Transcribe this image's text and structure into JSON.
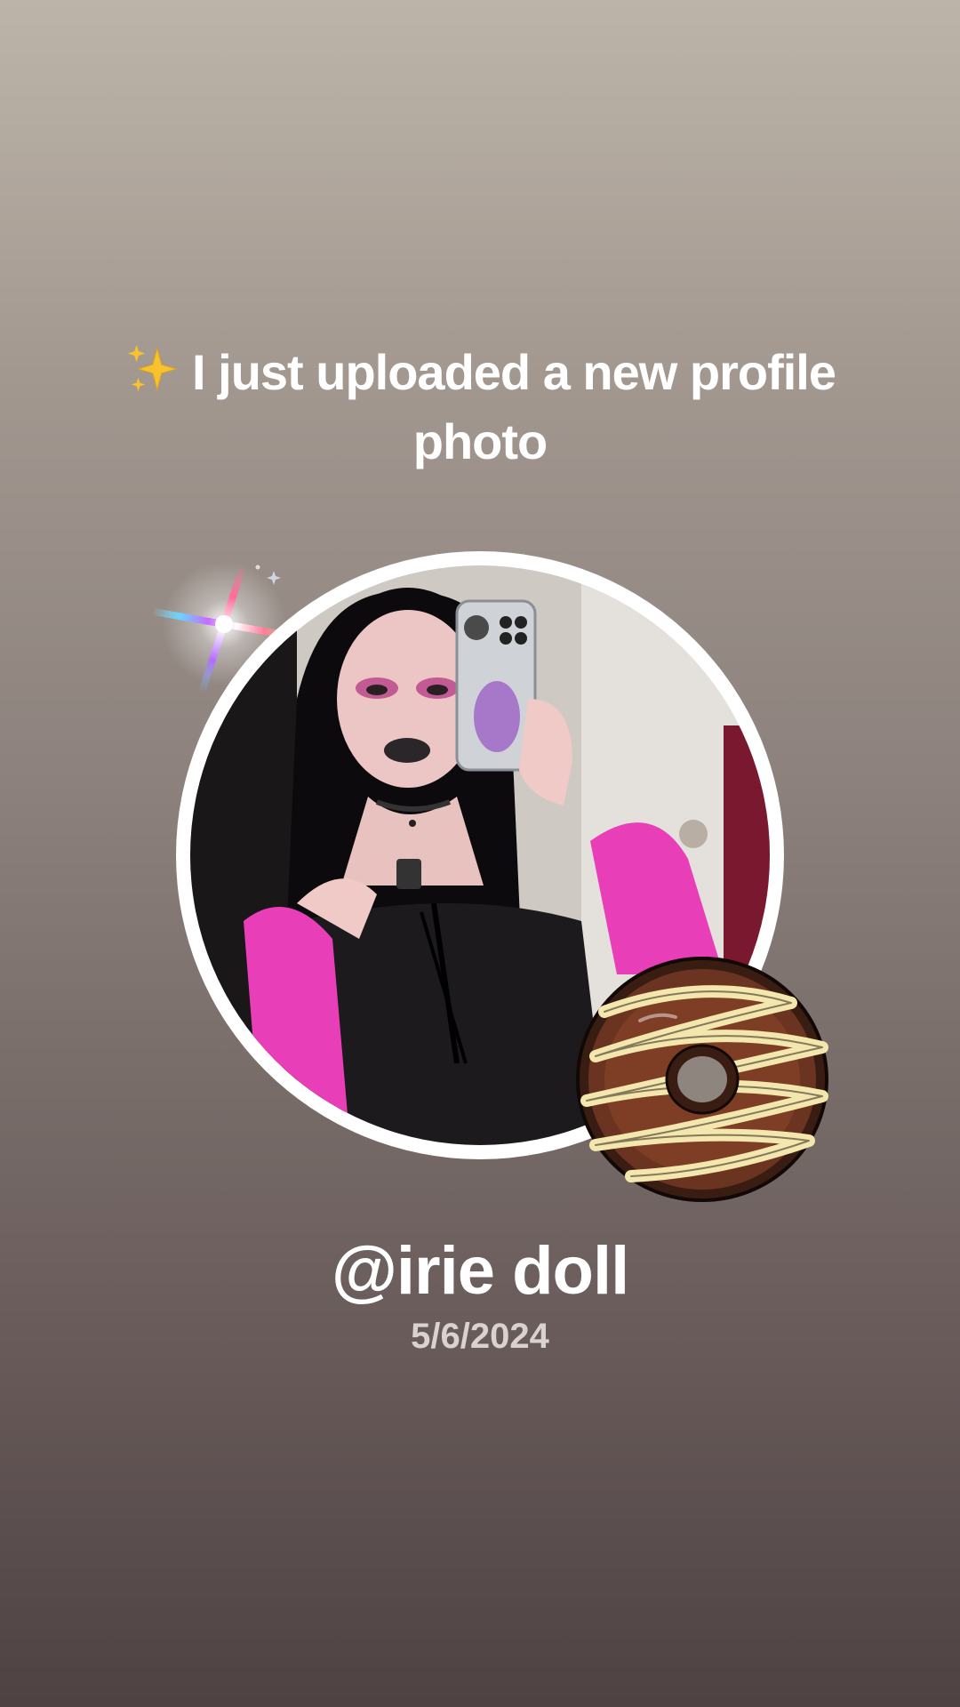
{
  "announcement": {
    "emoji_icon": "sparkles-icon",
    "text": "I just uploaded a new profile photo"
  },
  "profile": {
    "username": "@irie doll",
    "date": "5/6/2024",
    "photo_icon": "profile-photo",
    "sticker_icon": "donut-icon"
  },
  "colors": {
    "background_top": "#bdb4a9",
    "background_bottom": "#4f4243",
    "text": "#ffffff",
    "date_text": "#d9d2cf",
    "frame": "#ffffff"
  }
}
